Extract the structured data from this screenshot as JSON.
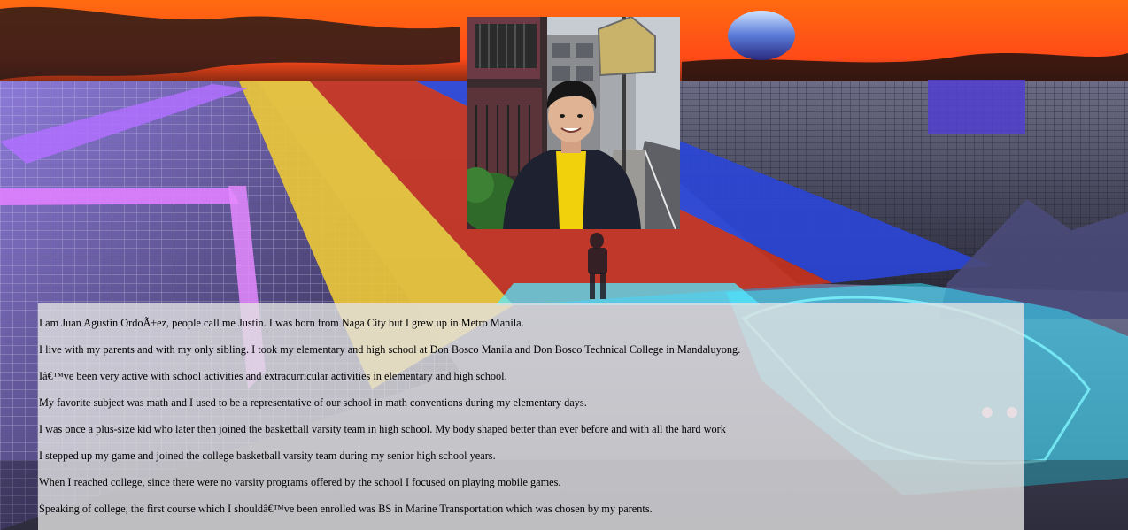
{
  "colors": {
    "sky_orange": "#ff5a1a",
    "grid_purple": "#b070ff",
    "road_yellow": "#e9c53a",
    "road_red": "#c8321e",
    "road_blue": "#2a46d8",
    "neon_cyan": "#37e6ff",
    "panel_bg": "#e2e2e2"
  },
  "profile": {
    "photo_description": "Portrait of a smiling young man in a dark jacket and yellow shirt on a city sidewalk"
  },
  "bio": {
    "paragraphs": [
      "I am Juan Agustin OrdoÃ±ez, people call me Justin. I was born from Naga City but I grew up in Metro Manila.",
      "I live with my parents and with my only sibling. I took my elementary and high school at Don Bosco Manila and Don Bosco Technical College in Mandaluyong.",
      "Iâ€™ve been very active with school activities and extracurricular activities in elementary and high school.",
      "My favorite subject was math and I used to be a representative of our school in math conventions during my elementary days.",
      "I was once a plus-size kid who later then joined the basketball varsity team in high school. My body shaped better than ever before and with all the hard work",
      "I stepped up my game and joined the college basketball varsity team during my senior high school years.",
      "When I reached college, since there were no varsity programs offered by the school I focused on playing mobile games.",
      "Speaking of college, the first course which I shouldâ€™ve been enrolled was BS in Marine Transportation which was chosen by my parents."
    ]
  }
}
